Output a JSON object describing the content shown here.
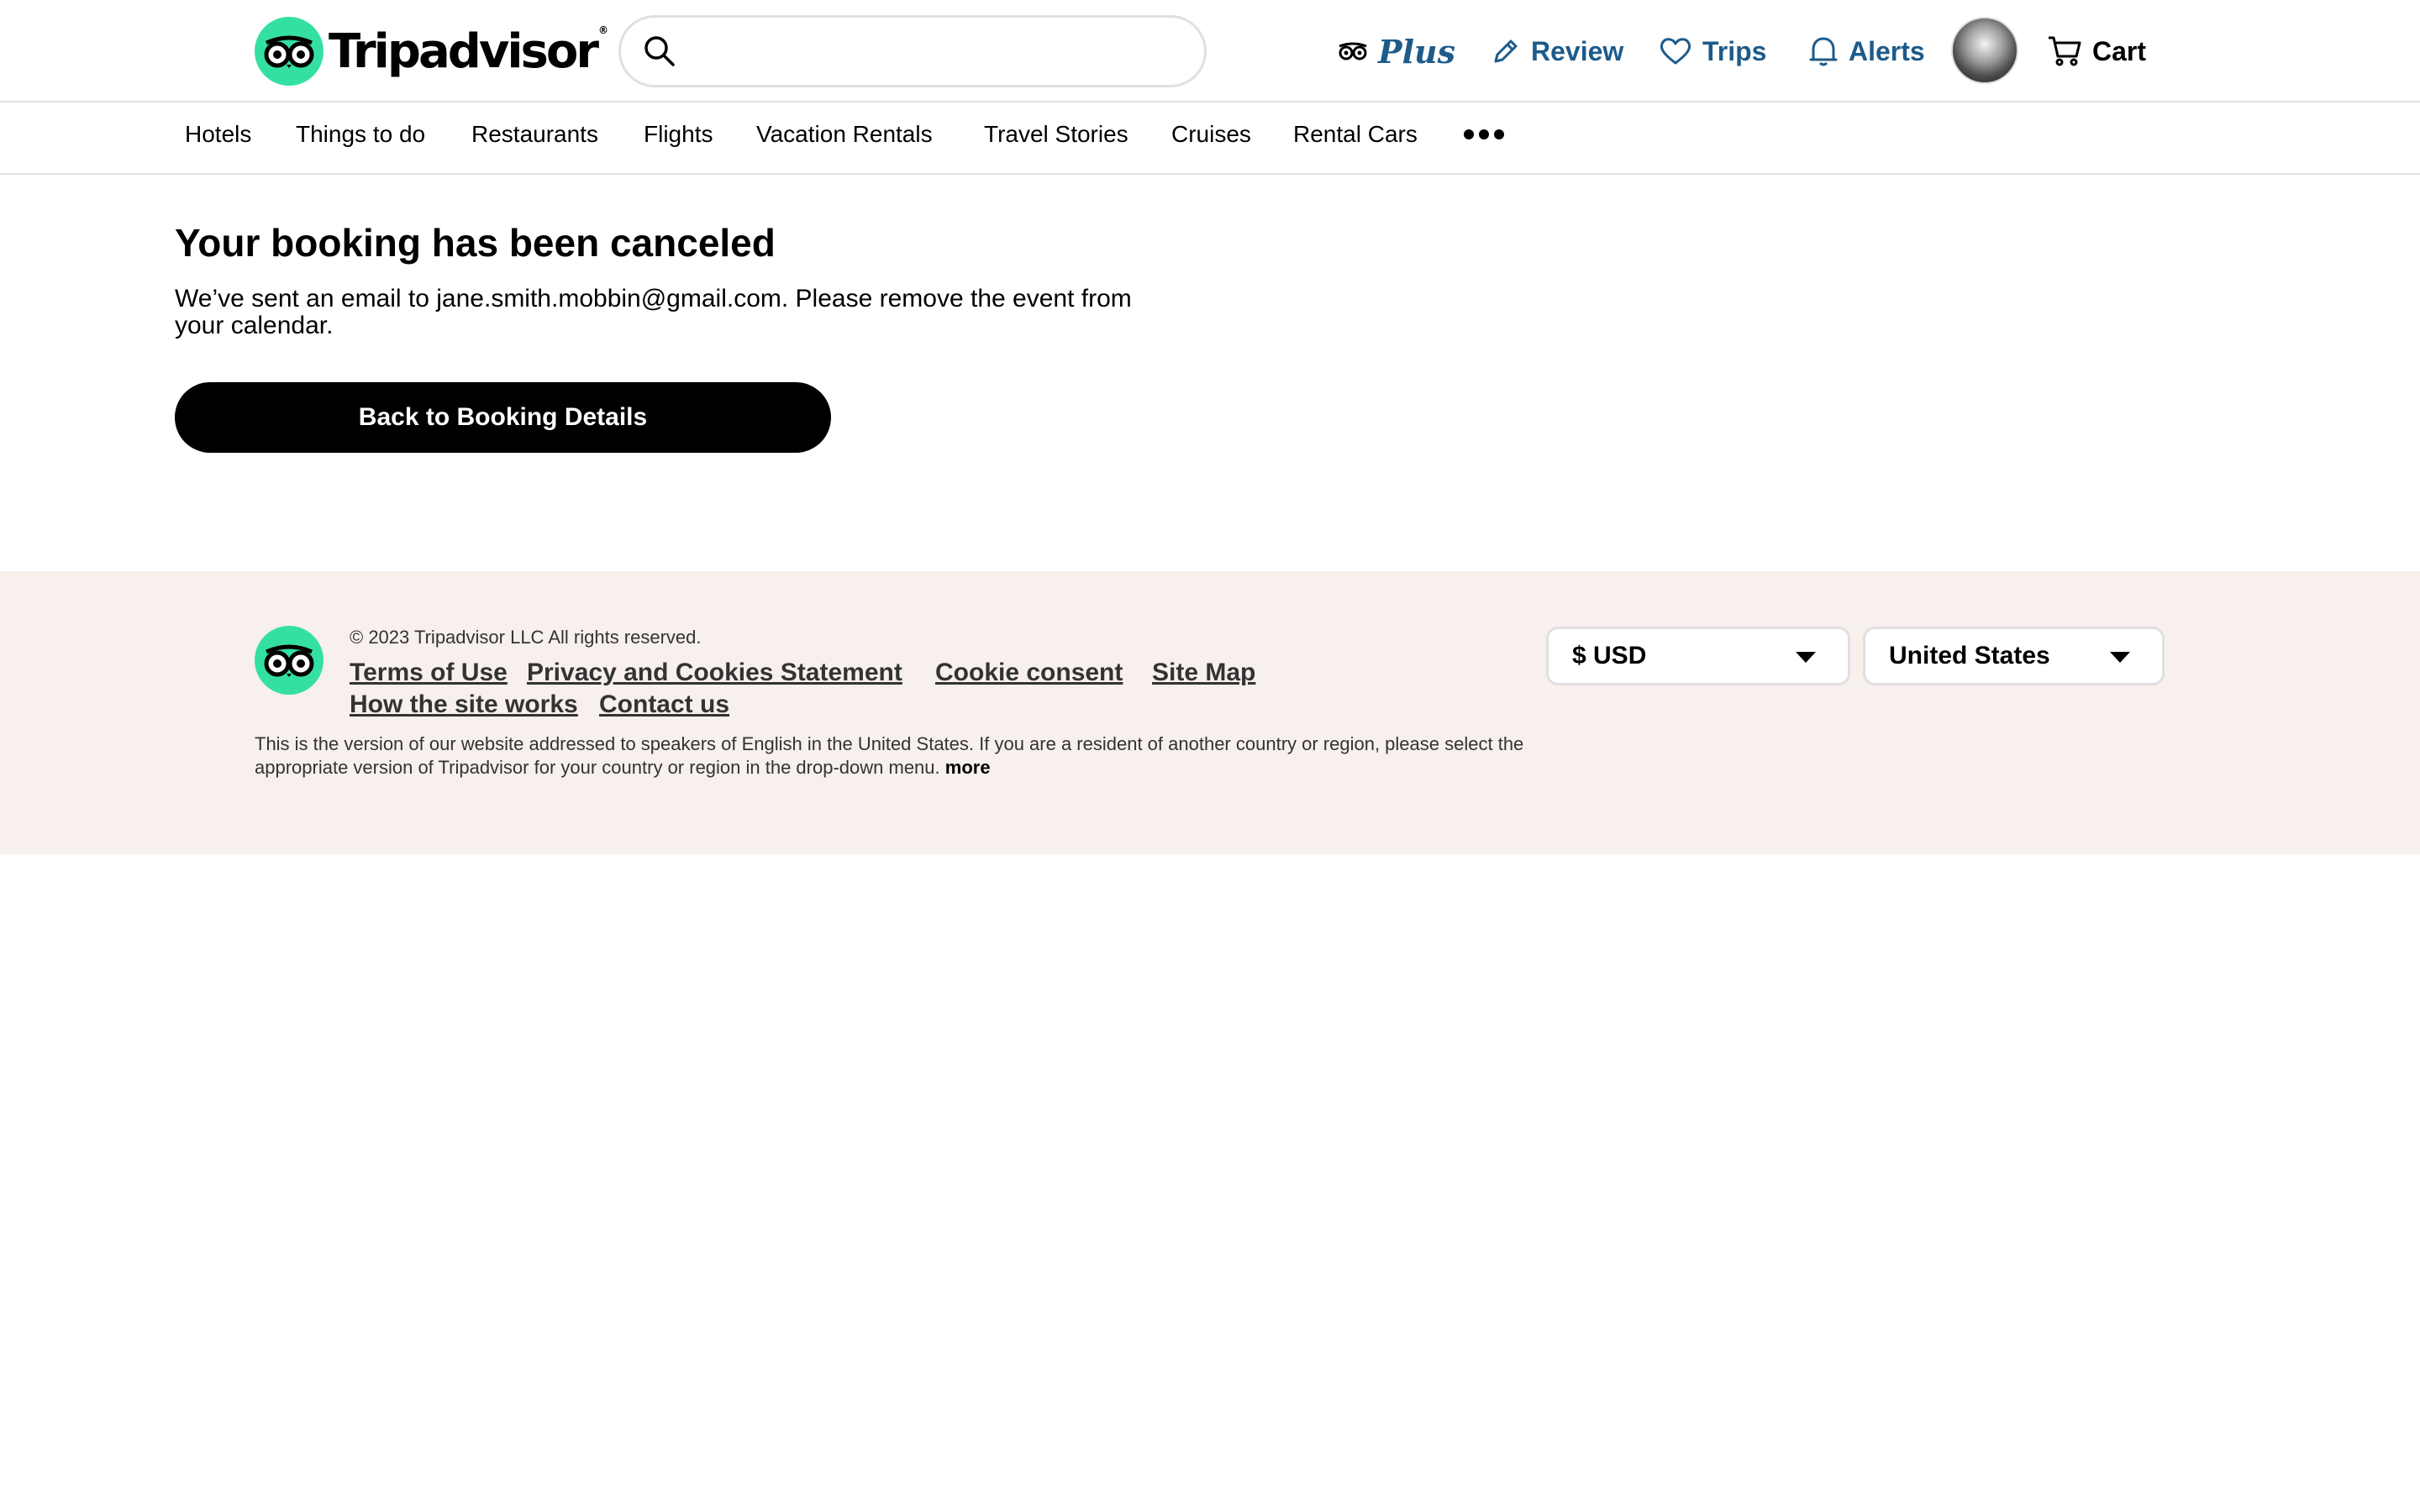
{
  "header": {
    "logo_text": "Tripadvisor",
    "search": {
      "placeholder": "",
      "value": ""
    },
    "actions": {
      "plus_label": "Plus",
      "review_label": "Review",
      "trips_label": "Trips",
      "alerts_label": "Alerts",
      "cart_label": "Cart"
    }
  },
  "categories": [
    "Hotels",
    "Things to do",
    "Restaurants",
    "Flights",
    "Vacation Rentals",
    "Travel Stories",
    "Cruises",
    "Rental Cars"
  ],
  "main": {
    "title": "Your booking has been canceled",
    "message": "We’ve sent an email to jane.smith.mobbin@gmail.com. Please remove the event from your calendar.",
    "back_button": "Back to Booking Details"
  },
  "footer": {
    "copyright": "© 2023 Tripadvisor LLC All rights reserved.",
    "links": [
      "Terms of Use",
      "Privacy and Cookies Statement",
      "Cookie consent",
      "Site Map",
      "How the site works",
      "Contact us"
    ],
    "disclaimer": "This is the version of our website addressed to speakers of English in the United States. If you are a resident of another country or region, please select the appropriate version of Tripadvisor for your country or region in the drop-down menu.",
    "disclaimer_more": "more",
    "currency": "$ USD",
    "region": "United States"
  },
  "colors": {
    "brand_green": "#34e0a1",
    "action_blue": "#1d5b8a",
    "footer_bg": "#f7f0ed",
    "button_bg": "#000000"
  },
  "icons": [
    "owl-logo-icon",
    "search-icon",
    "owl-plus-icon",
    "pencil-icon",
    "heart-icon",
    "bell-icon",
    "cart-icon",
    "more-dots-icon",
    "chevron-down-icon"
  ]
}
